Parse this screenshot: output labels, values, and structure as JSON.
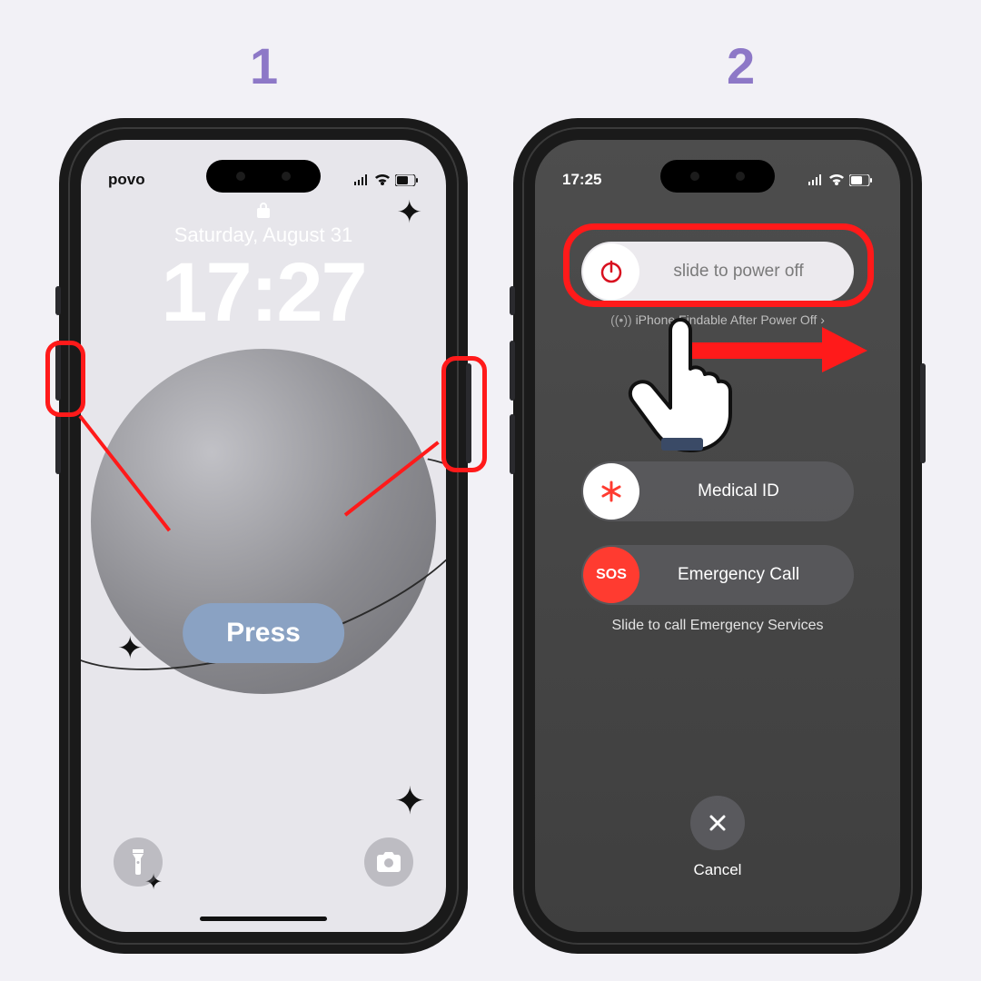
{
  "steps": {
    "one": "1",
    "two": "2"
  },
  "phone1": {
    "carrier": "povo",
    "date": "Saturday, August 31",
    "time": "17:27",
    "press_label": "Press",
    "flashlight_icon": "flashlight-icon",
    "camera_icon": "camera-icon"
  },
  "phone2": {
    "status_time": "17:25",
    "power_off_label": "slide to power off",
    "findable_text": "iPhone Findable After Power Off",
    "medical_label": "Medical ID",
    "sos_knob": "SOS",
    "sos_label": "Emergency Call",
    "sos_hint": "Slide to call Emergency Services",
    "cancel_label": "Cancel"
  },
  "colors": {
    "accent_red": "#ff1a1a",
    "step_purple": "#8d78c7",
    "press_blue": "#8aa2c3"
  }
}
